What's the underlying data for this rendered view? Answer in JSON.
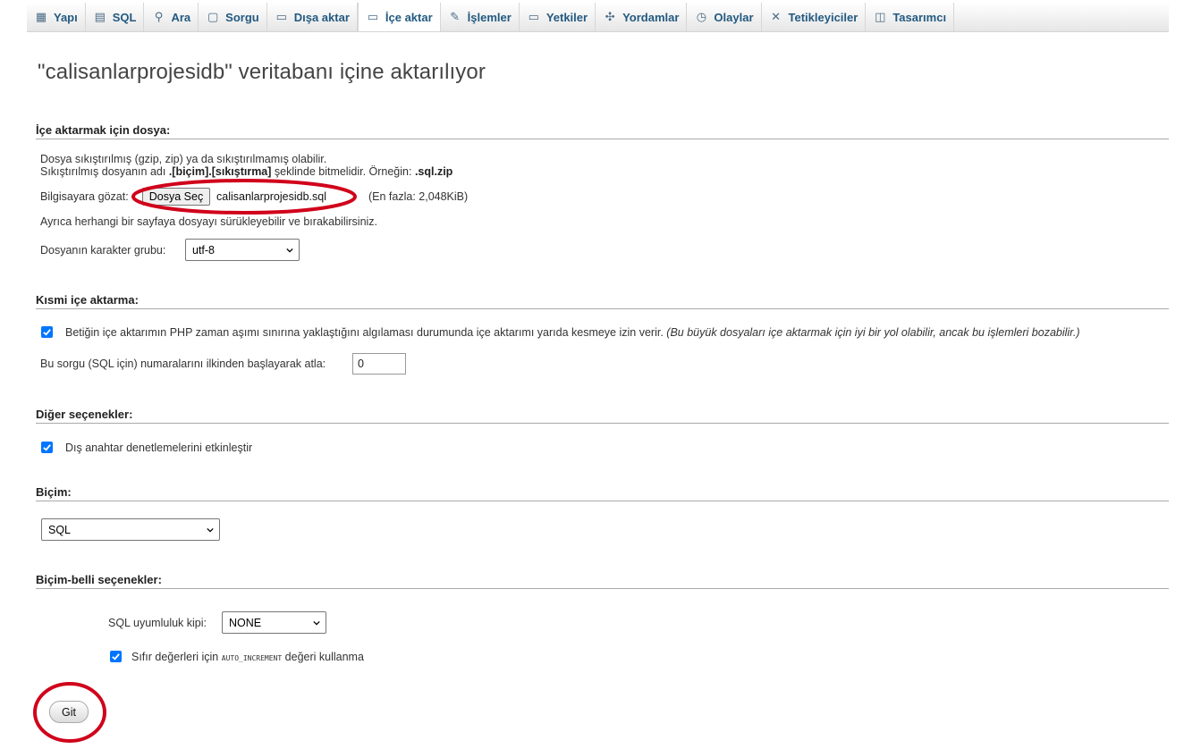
{
  "tabs": [
    {
      "label": "Yapı",
      "icon": "structure-icon",
      "glyph": "▦"
    },
    {
      "label": "SQL",
      "icon": "sql-icon",
      "glyph": "▤"
    },
    {
      "label": "Ara",
      "icon": "search-icon",
      "glyph": "⚲"
    },
    {
      "label": "Sorgu",
      "icon": "query-icon",
      "glyph": "▢"
    },
    {
      "label": "Dışa aktar",
      "icon": "export-icon",
      "glyph": "▭"
    },
    {
      "label": "İçe aktar",
      "icon": "import-icon",
      "glyph": "▭"
    },
    {
      "label": "İşlemler",
      "icon": "wrench-icon",
      "glyph": "✎"
    },
    {
      "label": "Yetkiler",
      "icon": "privileges-icon",
      "glyph": "▭"
    },
    {
      "label": "Yordamlar",
      "icon": "routines-icon",
      "glyph": "✣"
    },
    {
      "label": "Olaylar",
      "icon": "clock-icon",
      "glyph": "◷"
    },
    {
      "label": "Tetikleyiciler",
      "icon": "triggers-icon",
      "glyph": "✕"
    },
    {
      "label": "Tasarımcı",
      "icon": "designer-icon",
      "glyph": "◫"
    }
  ],
  "active_tab": "İçe aktar",
  "page_title": "\"calisanlarprojesidb\" veritabanı içine aktarılıyor",
  "file_section": {
    "title": "İçe aktarmak için dosya:",
    "line1": "Dosya sıkıştırılmış (gzip, zip) ya da sıkıştırılmamış olabilir.",
    "line2_pre": "Sıkıştırılmış dosyanın adı ",
    "line2_bold": ".[biçim].[sıkıştırma]",
    "line2_mid": " şeklinde bitmelidir. Örneğin: ",
    "line2_example": ".sql.zip",
    "browse_label": "Bilgisayara gözat:",
    "choose_button": "Dosya Seç",
    "chosen_file": "calisanlarprojesidb.sql",
    "max_size": "(En fazla: 2,048KiB)",
    "drag_hint": "Ayrıca herhangi bir sayfaya dosyayı sürükleyebilir ve bırakabilirsiniz.",
    "charset_label": "Dosyanın karakter grubu:",
    "charset_value": "utf-8"
  },
  "partial_section": {
    "title": "Kısmi içe aktarma:",
    "interrupt_label": "Betiğin içe aktarımın PHP zaman aşımı sınırına yaklaştığını algılaması durumunda içe aktarımı yarıda kesmeye izin verir.",
    "interrupt_note": "(Bu büyük dosyaları içe aktarmak için iyi bir yol olabilir, ancak bu işlemleri bozabilir.)",
    "skip_label": "Bu sorgu (SQL için) numaralarını ilkinden başlayarak atla:",
    "skip_value": "0"
  },
  "other_section": {
    "title": "Diğer seçenekler:",
    "fk_label": "Dış anahtar denetlemelerini etkinleştir"
  },
  "format_section": {
    "title": "Biçim:",
    "format_value": "SQL"
  },
  "format_options_section": {
    "title": "Biçim-belli seçenekler:",
    "compat_label": "SQL uyumluluk kipi:",
    "compat_value": "NONE",
    "auto_inc_pre": "Sıfır değerleri için",
    "auto_inc_code": "AUTO_INCREMENT",
    "auto_inc_post": "değeri kullanma"
  },
  "go_button": "Git",
  "colors": {
    "tab_text": "#235a81",
    "checkbox": "#0075ff",
    "annotation": "#d0021b"
  }
}
